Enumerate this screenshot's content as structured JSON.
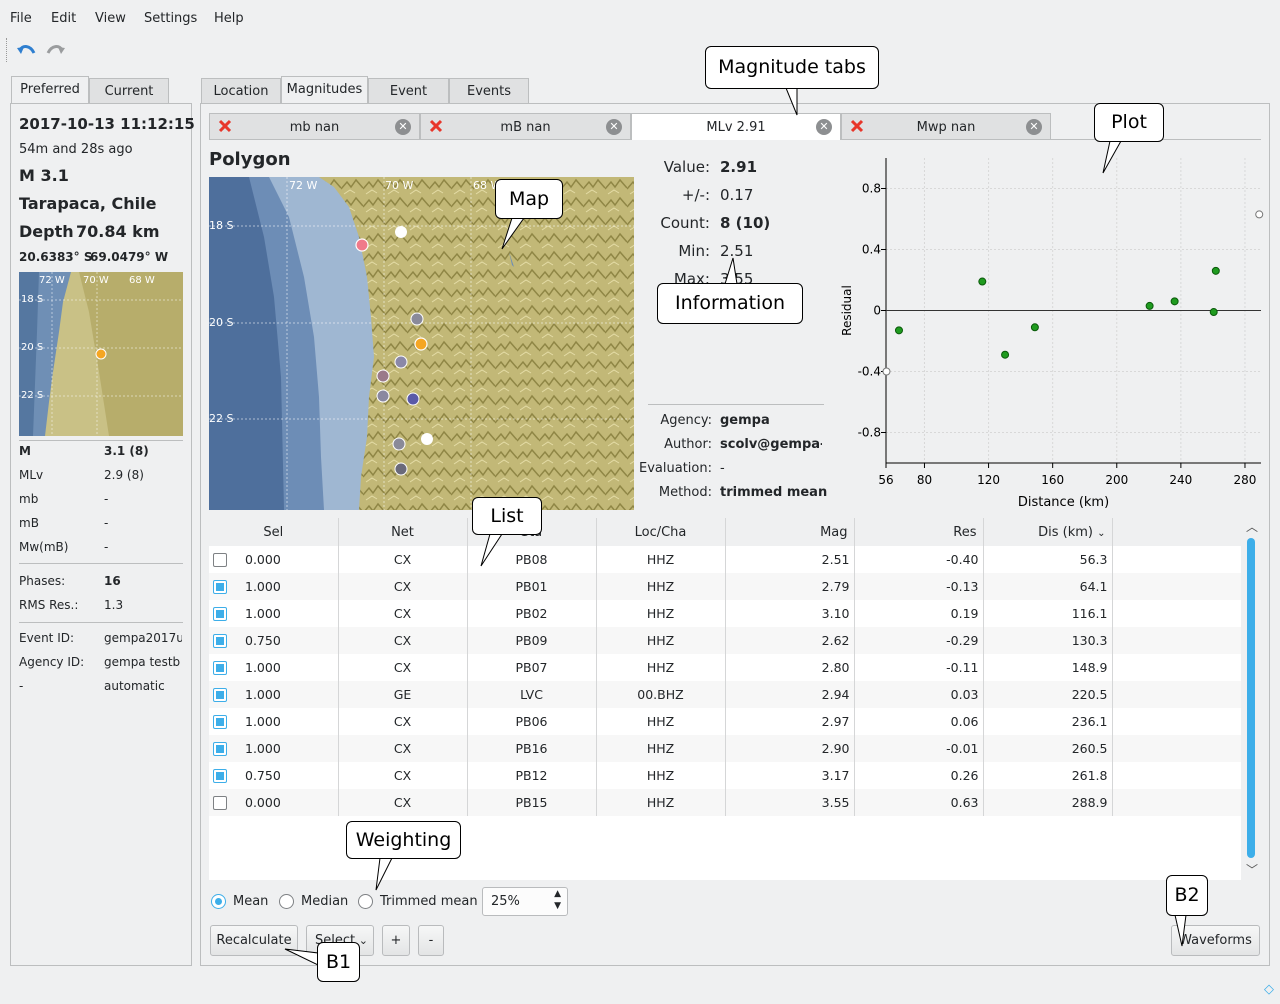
{
  "menu": {
    "file": "File",
    "edit": "Edit",
    "view": "View",
    "settings": "Settings",
    "help": "Help"
  },
  "left_tabs": {
    "preferred": "Preferred",
    "current": "Current"
  },
  "summary": {
    "datetime": "2017-10-13 11:12:15",
    "ago": "54m and 28s ago",
    "magnitude": "M 3.1",
    "region": "Tarapaca, Chile",
    "depth": "Depth",
    "depth_val": "70.84 km",
    "lat": "20.6383° S",
    "lon": "69.0479° W",
    "mini_map_labels": [
      "72 W",
      "70 W",
      "68 W",
      "18 S",
      "20 S",
      "22 S"
    ],
    "mags": [
      {
        "k": "M",
        "v": "3.1 (8)",
        "bold": true
      },
      {
        "k": "MLv",
        "v": "2.9 (8)"
      },
      {
        "k": "mb",
        "v": "-"
      },
      {
        "k": "mB",
        "v": "-"
      },
      {
        "k": "Mw(mB)",
        "v": "-"
      }
    ],
    "phases_lbl": "Phases:",
    "phases": "16",
    "rms_lbl": "RMS Res.:",
    "rms": "1.3",
    "eventid_lbl": "Event ID:",
    "eventid": "gempa2017u",
    "agencyid_lbl": "Agency ID:",
    "agencyid": "gempa testb",
    "mode_lbl": "-",
    "mode": "automatic"
  },
  "main_tabs": {
    "location": "Location",
    "magnitudes": "Magnitudes",
    "event": "Event",
    "events": "Events"
  },
  "mag_tabs": [
    {
      "label": "mb nan",
      "error": true
    },
    {
      "label": "mB nan",
      "error": true
    },
    {
      "label": "MLv 2.91",
      "error": false
    },
    {
      "label": "Mwp nan",
      "error": true
    }
  ],
  "map": {
    "title": "Polygon",
    "labels": [
      "72 W",
      "70 W",
      "68 W",
      "18 S",
      "20 S",
      "22 S"
    ]
  },
  "info": {
    "value_lbl": "Value:",
    "value": "2.91",
    "pm_lbl": "+/-:",
    "pm": "0.17",
    "count_lbl": "Count:",
    "count": "8 (10)",
    "min_lbl": "Min:",
    "min": "2.51",
    "max_lbl": "Max:",
    "max": "3.55",
    "agency_lbl": "Agency:",
    "agency": "gempa",
    "author_lbl": "Author:",
    "author": "scolv@gempa-ja",
    "evaluation_lbl": "Evaluation:",
    "evaluation": "-",
    "method_lbl": "Method:",
    "method": "trimmed mean"
  },
  "chart_data": {
    "type": "scatter",
    "xlabel": "Distance (km)",
    "ylabel": "Residual",
    "xlim": [
      56,
      290
    ],
    "ylim": [
      -1.0,
      1.0
    ],
    "xticks": [
      "56",
      "80",
      "120",
      "160",
      "200",
      "240",
      "280"
    ],
    "yticks": [
      "0.8",
      "0.4",
      "0",
      "-0.4",
      "-0.8"
    ],
    "points": [
      {
        "x": 64.1,
        "y": -0.13,
        "active": true
      },
      {
        "x": 116.1,
        "y": 0.19,
        "active": true
      },
      {
        "x": 130.3,
        "y": -0.29,
        "active": true
      },
      {
        "x": 148.9,
        "y": -0.11,
        "active": true
      },
      {
        "x": 220.5,
        "y": 0.03,
        "active": true
      },
      {
        "x": 236.1,
        "y": 0.06,
        "active": true
      },
      {
        "x": 260.5,
        "y": -0.01,
        "active": true
      },
      {
        "x": 261.8,
        "y": 0.26,
        "active": true
      },
      {
        "x": 56.3,
        "y": -0.4,
        "active": false
      },
      {
        "x": 288.9,
        "y": 0.63,
        "active": false
      }
    ]
  },
  "table": {
    "headers": [
      "Sel",
      "Net",
      "Sta",
      "Loc/Cha",
      "Mag",
      "Res",
      "Dis (km)"
    ],
    "rows": [
      {
        "sel": false,
        "w": "0.000",
        "net": "CX",
        "sta": "PB08",
        "cha": "HHZ",
        "mag": "2.51",
        "res": "-0.40",
        "dis": "56.3"
      },
      {
        "sel": true,
        "w": "1.000",
        "net": "CX",
        "sta": "PB01",
        "cha": "HHZ",
        "mag": "2.79",
        "res": "-0.13",
        "dis": "64.1"
      },
      {
        "sel": true,
        "w": "1.000",
        "net": "CX",
        "sta": "PB02",
        "cha": "HHZ",
        "mag": "3.10",
        "res": "0.19",
        "dis": "116.1"
      },
      {
        "sel": true,
        "w": "0.750",
        "net": "CX",
        "sta": "PB09",
        "cha": "HHZ",
        "mag": "2.62",
        "res": "-0.29",
        "dis": "130.3"
      },
      {
        "sel": true,
        "w": "1.000",
        "net": "CX",
        "sta": "PB07",
        "cha": "HHZ",
        "mag": "2.80",
        "res": "-0.11",
        "dis": "148.9"
      },
      {
        "sel": true,
        "w": "1.000",
        "net": "GE",
        "sta": "LVC",
        "cha": "00.BHZ",
        "mag": "2.94",
        "res": "0.03",
        "dis": "220.5"
      },
      {
        "sel": true,
        "w": "1.000",
        "net": "CX",
        "sta": "PB06",
        "cha": "HHZ",
        "mag": "2.97",
        "res": "0.06",
        "dis": "236.1"
      },
      {
        "sel": true,
        "w": "1.000",
        "net": "CX",
        "sta": "PB16",
        "cha": "HHZ",
        "mag": "2.90",
        "res": "-0.01",
        "dis": "260.5"
      },
      {
        "sel": true,
        "w": "0.750",
        "net": "CX",
        "sta": "PB12",
        "cha": "HHZ",
        "mag": "3.17",
        "res": "0.26",
        "dis": "261.8"
      },
      {
        "sel": false,
        "w": "0.000",
        "net": "CX",
        "sta": "PB15",
        "cha": "HHZ",
        "mag": "3.55",
        "res": "0.63",
        "dis": "288.9"
      }
    ]
  },
  "weighting": {
    "mean": "Mean",
    "median": "Median",
    "trimmed": "Trimmed mean",
    "percent": "25%",
    "selected": "mean"
  },
  "buttons": {
    "recalculate": "Recalculate",
    "select": "Select",
    "plus": "+",
    "minus": "-",
    "waveforms": "Waveforms"
  },
  "callouts": {
    "magtabs": "Magnitude tabs",
    "plot": "Plot",
    "map": "Map",
    "information": "Information",
    "list": "List",
    "weighting": "Weighting",
    "b1": "B1",
    "b2": "B2"
  },
  "colors": {
    "accent": "#3daee9",
    "point_active": "#1f9b1f",
    "quake": "#f5a623"
  }
}
